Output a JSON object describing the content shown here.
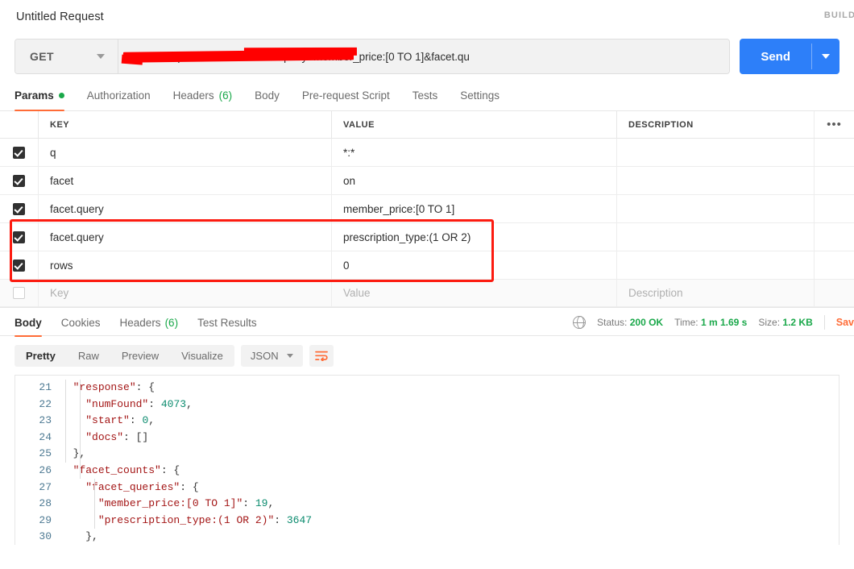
{
  "titlebar": {
    "request_name": "Untitled Request",
    "build_label": "BUILD"
  },
  "url_bar": {
    "method": "GET",
    "url_visible": "n/search?q=*:*&facet=on&facet.query=member_price:[0 TO 1]&facet.qu",
    "url_redacted": true,
    "send_label": "Send"
  },
  "request_tabs": [
    {
      "label": "Params",
      "badge": "dot",
      "active": true
    },
    {
      "label": "Authorization",
      "badge": "",
      "active": false
    },
    {
      "label": "Headers",
      "badge": "(6)",
      "active": false
    },
    {
      "label": "Body",
      "badge": "",
      "active": false
    },
    {
      "label": "Pre-request Script",
      "badge": "",
      "active": false
    },
    {
      "label": "Tests",
      "badge": "",
      "active": false
    },
    {
      "label": "Settings",
      "badge": "",
      "active": false
    }
  ],
  "params_table": {
    "headers": {
      "key": "KEY",
      "value": "VALUE",
      "description": "DESCRIPTION",
      "more": "•••"
    },
    "rows": [
      {
        "checked": true,
        "key": "q",
        "value": "*:*",
        "description": ""
      },
      {
        "checked": true,
        "key": "facet",
        "value": "on",
        "description": ""
      },
      {
        "checked": true,
        "key": "facet.query",
        "value": "member_price:[0 TO 1]",
        "description": ""
      },
      {
        "checked": true,
        "key": "facet.query",
        "value": "prescription_type:(1 OR 2)",
        "description": ""
      },
      {
        "checked": true,
        "key": "rows",
        "value": "0",
        "description": ""
      }
    ],
    "new_row": {
      "key_placeholder": "Key",
      "value_placeholder": "Value",
      "description_placeholder": "Description"
    }
  },
  "annotation": {
    "color": "#fc1b10",
    "highlights_rows": [
      2,
      3
    ]
  },
  "response_tabs": [
    {
      "label": "Body",
      "badge": "",
      "active": true
    },
    {
      "label": "Cookies",
      "badge": "",
      "active": false
    },
    {
      "label": "Headers",
      "badge": "(6)",
      "active": false
    },
    {
      "label": "Test Results",
      "badge": "",
      "active": false
    }
  ],
  "response_meta": {
    "globe_icon": "globe-icon",
    "status_label": "Status:",
    "status_value": "200 OK",
    "time_label": "Time:",
    "time_value": "1 m 1.69 s",
    "size_label": "Size:",
    "size_value": "1.2 KB",
    "save_label": "Sav"
  },
  "format_bar": {
    "views": [
      {
        "label": "Pretty",
        "active": true
      },
      {
        "label": "Raw",
        "active": false
      },
      {
        "label": "Preview",
        "active": false
      },
      {
        "label": "Visualize",
        "active": false
      }
    ],
    "content_type": "JSON",
    "wrap_icon": "word-wrap-icon"
  },
  "code_viewer": {
    "line_numbers": [
      "21",
      "22",
      "23",
      "24",
      "25",
      "26",
      "27",
      "28",
      "29",
      "30"
    ],
    "lines": [
      {
        "indent": 2,
        "segments": [
          {
            "t": "\"response\"",
            "c": "k"
          },
          {
            "t": ": {",
            "c": "p"
          }
        ]
      },
      {
        "indent": 4,
        "segments": [
          {
            "t": "\"numFound\"",
            "c": "k"
          },
          {
            "t": ": ",
            "c": "p"
          },
          {
            "t": "4073",
            "c": "n"
          },
          {
            "t": ",",
            "c": "p"
          }
        ]
      },
      {
        "indent": 4,
        "segments": [
          {
            "t": "\"start\"",
            "c": "k"
          },
          {
            "t": ": ",
            "c": "p"
          },
          {
            "t": "0",
            "c": "n"
          },
          {
            "t": ",",
            "c": "p"
          }
        ]
      },
      {
        "indent": 4,
        "segments": [
          {
            "t": "\"docs\"",
            "c": "k"
          },
          {
            "t": ": []",
            "c": "p"
          }
        ]
      },
      {
        "indent": 2,
        "segments": [
          {
            "t": "},",
            "c": "p"
          }
        ]
      },
      {
        "indent": 2,
        "segments": [
          {
            "t": "\"facet_counts\"",
            "c": "k"
          },
          {
            "t": ": {",
            "c": "p"
          }
        ]
      },
      {
        "indent": 4,
        "segments": [
          {
            "t": "\"facet_queries\"",
            "c": "k"
          },
          {
            "t": ": {",
            "c": "p"
          }
        ]
      },
      {
        "indent": 6,
        "segments": [
          {
            "t": "\"member_price:[0 TO 1]\"",
            "c": "k"
          },
          {
            "t": ": ",
            "c": "p"
          },
          {
            "t": "19",
            "c": "n"
          },
          {
            "t": ",",
            "c": "p"
          }
        ]
      },
      {
        "indent": 6,
        "segments": [
          {
            "t": "\"prescription_type:(1 OR 2)\"",
            "c": "k"
          },
          {
            "t": ": ",
            "c": "p"
          },
          {
            "t": "3647",
            "c": "n"
          }
        ]
      },
      {
        "indent": 4,
        "segments": [
          {
            "t": "},",
            "c": "p"
          }
        ]
      }
    ]
  },
  "colors": {
    "accent_orange": "#ff6c37",
    "send_blue": "#2d7ff9",
    "status_green": "#1aa84a",
    "annotation_red": "#fc1b10",
    "json_key": "#a31515",
    "json_number": "#0b8b6e",
    "line_number": "#4e7a93"
  }
}
